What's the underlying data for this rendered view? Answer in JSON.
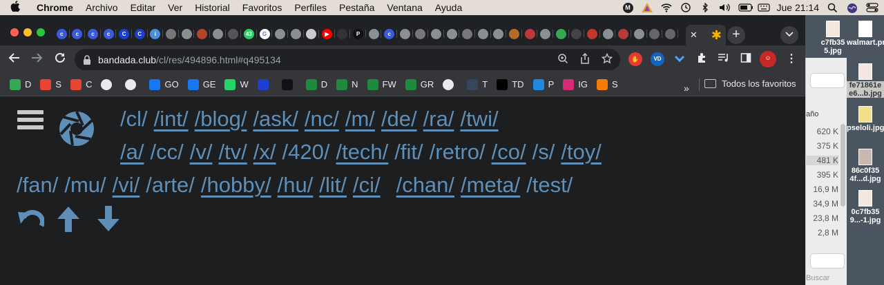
{
  "menubar": {
    "app_name": "Chrome",
    "items": [
      "Archivo",
      "Editar",
      "Ver",
      "Historial",
      "Favoritos",
      "Perfiles",
      "Pestaña",
      "Ventana",
      "Ayuda"
    ],
    "clock": "Jue 21:14",
    "status_m": "M"
  },
  "tabs": {
    "favicons": [
      {
        "icon": "clean-icon",
        "color": "#3b5bdb",
        "text": "c"
      },
      {
        "icon": "clean-icon",
        "color": "#3b5bdb",
        "text": "c"
      },
      {
        "icon": "clean-icon",
        "color": "#3b5bdb",
        "text": "c"
      },
      {
        "icon": "clean-icon",
        "color": "#3b5bdb",
        "text": "c"
      },
      {
        "icon": "clean-icon",
        "color": "#1a3fd1",
        "text": "C"
      },
      {
        "icon": "clean-icon",
        "color": "#1a3fd1",
        "text": "C"
      },
      {
        "icon": "info-icon",
        "color": "#4a90d9",
        "text": "i"
      },
      {
        "icon": "image-icon",
        "color": "#777777",
        "text": ""
      },
      {
        "icon": "chrome-icon",
        "color": "#8a8f94",
        "text": ""
      },
      {
        "icon": "site-icon",
        "color": "#b4452a",
        "text": ""
      },
      {
        "icon": "chrome-icon",
        "color": "#8a8f94",
        "text": ""
      },
      {
        "icon": "site-icon",
        "color": "#555555",
        "text": ""
      },
      {
        "icon": "whatsapp-icon",
        "color": "#25d366",
        "text": "43"
      },
      {
        "icon": "google-icon",
        "color": "#ffffff",
        "text": "G"
      },
      {
        "icon": "chrome-icon",
        "color": "#8a8f94",
        "text": ""
      },
      {
        "icon": "chrome-icon",
        "color": "#8a8f94",
        "text": ""
      },
      {
        "icon": "chrome-icon",
        "color": "#cccccc",
        "text": ""
      },
      {
        "icon": "youtube-icon",
        "color": "#ff0000",
        "text": "▶"
      },
      {
        "icon": "site-icon",
        "color": "#333333",
        "text": ""
      },
      {
        "icon": "patreon-icon",
        "color": "#111111",
        "text": "P"
      },
      {
        "icon": "chrome-icon",
        "color": "#8a8f94",
        "text": ""
      },
      {
        "icon": "clean-icon",
        "color": "#3b5bdb",
        "text": "c"
      },
      {
        "icon": "chrome-icon",
        "color": "#8a8f94",
        "text": ""
      },
      {
        "icon": "site-icon",
        "color": "#777777",
        "text": ""
      },
      {
        "icon": "chrome-icon",
        "color": "#8a8f94",
        "text": ""
      },
      {
        "icon": "chrome-icon",
        "color": "#8a8f94",
        "text": ""
      },
      {
        "icon": "site-icon",
        "color": "#777777",
        "text": ""
      },
      {
        "icon": "chrome-icon",
        "color": "#8a8f94",
        "text": ""
      },
      {
        "icon": "chrome-icon",
        "color": "#8a8f94",
        "text": ""
      },
      {
        "icon": "site-icon",
        "color": "#b76a2a",
        "text": ""
      },
      {
        "icon": "site-icon",
        "color": "#b83a3a",
        "text": ""
      },
      {
        "icon": "chrome-icon",
        "color": "#8a8f94",
        "text": ""
      },
      {
        "icon": "drive-icon",
        "color": "#34a853",
        "text": ""
      },
      {
        "icon": "site-icon",
        "color": "#444444",
        "text": ""
      },
      {
        "icon": "site-icon",
        "color": "#c0392b",
        "text": ""
      },
      {
        "icon": "chrome-icon",
        "color": "#8a8f94",
        "text": ""
      },
      {
        "icon": "site-icon",
        "color": "#b83a3a",
        "text": ""
      },
      {
        "icon": "chrome-icon",
        "color": "#8a8f94",
        "text": ""
      },
      {
        "icon": "site-icon",
        "color": "#666666",
        "text": ""
      },
      {
        "icon": "site-icon",
        "color": "#666666",
        "text": ""
      }
    ],
    "active_close": "✕"
  },
  "toolbar": {
    "url_host": "bandada.club",
    "url_path": "/cl/res/494896.html#q495134"
  },
  "bookmarks": {
    "items": [
      {
        "icon": "drive-icon",
        "color": "#34a853",
        "label": "D"
      },
      {
        "icon": "gmail-icon",
        "color": "#ea4335",
        "label": "S"
      },
      {
        "icon": "gmail-icon",
        "color": "#ea4335",
        "label": "C"
      },
      {
        "icon": "globe-icon",
        "color": "#9aa0a6",
        "label": ""
      },
      {
        "icon": "globe-icon",
        "color": "#9aa0a6",
        "label": ""
      },
      {
        "icon": "facebook-icon",
        "color": "#1877f2",
        "label": "GO"
      },
      {
        "icon": "facebook-icon",
        "color": "#1877f2",
        "label": "GE"
      },
      {
        "icon": "whatsapp-icon",
        "color": "#25d366",
        "label": "W"
      },
      {
        "icon": "clean-icon",
        "color": "#1a3fd1",
        "label": ""
      },
      {
        "icon": "patreon-icon",
        "color": "#111111",
        "label": ""
      },
      {
        "icon": "site-icon",
        "color": "#1f8a3a",
        "label": "D"
      },
      {
        "icon": "site-icon",
        "color": "#1f8a3a",
        "label": "N"
      },
      {
        "icon": "site-icon",
        "color": "#1f8a3a",
        "label": "FW"
      },
      {
        "icon": "site-icon",
        "color": "#1f8a3a",
        "label": "GR"
      },
      {
        "icon": "globe-icon",
        "color": "#9aa0a6",
        "label": ""
      },
      {
        "icon": "tumblr-icon",
        "color": "#36465d",
        "label": "T"
      },
      {
        "icon": "x-icon",
        "color": "#000000",
        "label": "TD"
      },
      {
        "icon": "site-icon",
        "color": "#1e88e5",
        "label": "P"
      },
      {
        "icon": "instagram-icon",
        "color": "#d62976",
        "label": "IG"
      },
      {
        "icon": "site-icon",
        "color": "#f57c00",
        "label": "S"
      }
    ],
    "more": "»",
    "all_label": "Todos los favoritos"
  },
  "boards": {
    "row1": [
      {
        "label": "/cl/",
        "link": false
      },
      {
        "label": "/int/",
        "link": true
      },
      {
        "label": "/blog/",
        "link": true
      },
      {
        "label": "/ask/",
        "link": true
      },
      {
        "label": "/nc/",
        "link": true
      },
      {
        "label": "/m/",
        "link": true
      },
      {
        "label": "/de/",
        "link": true
      },
      {
        "label": "/ra/",
        "link": true
      },
      {
        "label": "/twi/",
        "link": true
      }
    ],
    "row2": [
      {
        "label": "/a/",
        "link": true
      },
      {
        "label": "/cc/",
        "link": false
      },
      {
        "label": "/v/",
        "link": true
      },
      {
        "label": "/tv/",
        "link": true
      },
      {
        "label": "/x/",
        "link": true
      },
      {
        "label": "/420/",
        "link": false
      },
      {
        "label": "/tech/",
        "link": true
      },
      {
        "label": "/fit/",
        "link": false
      },
      {
        "label": "/retro/",
        "link": false
      },
      {
        "label": "/co/",
        "link": true
      },
      {
        "label": "/s/",
        "link": false
      },
      {
        "label": "/toy/",
        "link": true
      }
    ],
    "row3": [
      {
        "label": "/fan/",
        "link": false
      },
      {
        "label": "/mu/",
        "link": false
      },
      {
        "label": "/vi/",
        "link": true
      },
      {
        "label": "/arte/",
        "link": false
      },
      {
        "label": "/hobby/",
        "link": true
      },
      {
        "label": "/hu/",
        "link": true
      },
      {
        "label": "/lit/",
        "link": true
      },
      {
        "label": "/ci/",
        "link": true
      },
      {
        "label": "/chan/",
        "link": true
      },
      {
        "label": "/meta/",
        "link": true
      },
      {
        "label": "/test/",
        "link": false
      }
    ]
  },
  "finder": {
    "column_header": "año",
    "sizes": [
      "620 K",
      "375 K",
      "481 K",
      "395 K",
      "16,9 M",
      "34,9 M",
      "23,8 M",
      "2,8 M"
    ],
    "search_placeholder": "Buscar"
  },
  "desktop_files": [
    {
      "label": "c7fb35\n5.jpg",
      "selected": false
    },
    {
      "label": "walmart.png",
      "selected": false
    },
    {
      "label": "fe71861e\ne6...b.jpg",
      "selected": true
    },
    {
      "label": "pseloli.jpg",
      "selected": false
    },
    {
      "label": "86c0f35\n4f...d.jpg",
      "selected": false
    },
    {
      "label": "0c7fb35\n9...-1.jpg",
      "selected": false
    }
  ]
}
